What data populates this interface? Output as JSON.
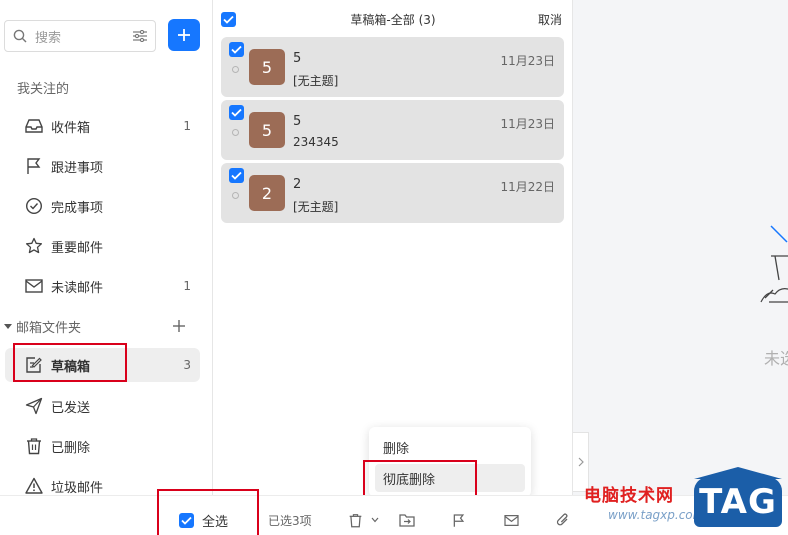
{
  "sidebar": {
    "search_placeholder": "搜索",
    "section_title": "我关注的",
    "items": [
      {
        "label": "收件箱",
        "count": "1"
      },
      {
        "label": "跟进事项",
        "count": ""
      },
      {
        "label": "完成事项",
        "count": ""
      },
      {
        "label": "重要邮件",
        "count": ""
      },
      {
        "label": "未读邮件",
        "count": "1"
      }
    ],
    "folder_title": "邮箱文件夹",
    "folders": [
      {
        "label": "草稿箱",
        "count": "3"
      },
      {
        "label": "已发送",
        "count": ""
      },
      {
        "label": "已删除",
        "count": ""
      },
      {
        "label": "垃圾邮件",
        "count": ""
      }
    ]
  },
  "list": {
    "title": "草稿箱-全部 (3)",
    "cancel_label": "取消",
    "mails": [
      {
        "avatar": "5",
        "sender": "5",
        "subject": "[无主题]",
        "date": "11月23日"
      },
      {
        "avatar": "5",
        "sender": "5",
        "subject": "234345",
        "date": "11月23日"
      },
      {
        "avatar": "2",
        "sender": "2",
        "subject": "[无主题]",
        "date": "11月22日"
      }
    ]
  },
  "preview": {
    "empty_text": "未选"
  },
  "menu": {
    "delete_label": "删除",
    "permanent_delete_label": "彻底删除"
  },
  "bottom": {
    "select_all_label": "全选",
    "selected_text": "已选3项"
  },
  "watermark": {
    "text": "电脑技术网",
    "url": "www.tagxp.com",
    "logo": "TAG"
  },
  "colors": {
    "accent": "#1677ff",
    "highlight": "#d9001b",
    "avatar": "#9c6c56",
    "card": "#e3e3e3"
  }
}
